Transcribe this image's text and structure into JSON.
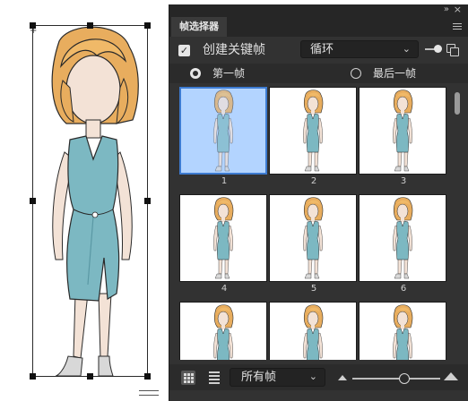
{
  "panel": {
    "title": "帧选择器",
    "collapse_icon": "double-chevron-right",
    "close_icon": "close-x",
    "menu_icon": "hamburger-menu"
  },
  "keyframe": {
    "checked": true,
    "label": "创建关键帧"
  },
  "loop_select": {
    "value": "循环"
  },
  "frame_range": {
    "first_label": "第一帧",
    "last_label": "最后一帧",
    "selected": "first"
  },
  "frames": [
    {
      "number": "1",
      "selected": true
    },
    {
      "number": "2",
      "selected": false
    },
    {
      "number": "3",
      "selected": false
    },
    {
      "number": "4",
      "selected": false
    },
    {
      "number": "5",
      "selected": false
    },
    {
      "number": "6",
      "selected": false
    },
    {
      "number": "",
      "selected": false
    },
    {
      "number": "",
      "selected": false
    },
    {
      "number": "",
      "selected": false
    }
  ],
  "bottom": {
    "filter_value": "所有帧",
    "zoom_level": 0.6
  },
  "colors": {
    "panel_bg": "#323232",
    "selected_frame_bg": "#b3d4ff",
    "selected_frame_border": "#3d7bd1",
    "dress": "#7cb8c2",
    "hair": "#e8ad5e"
  }
}
